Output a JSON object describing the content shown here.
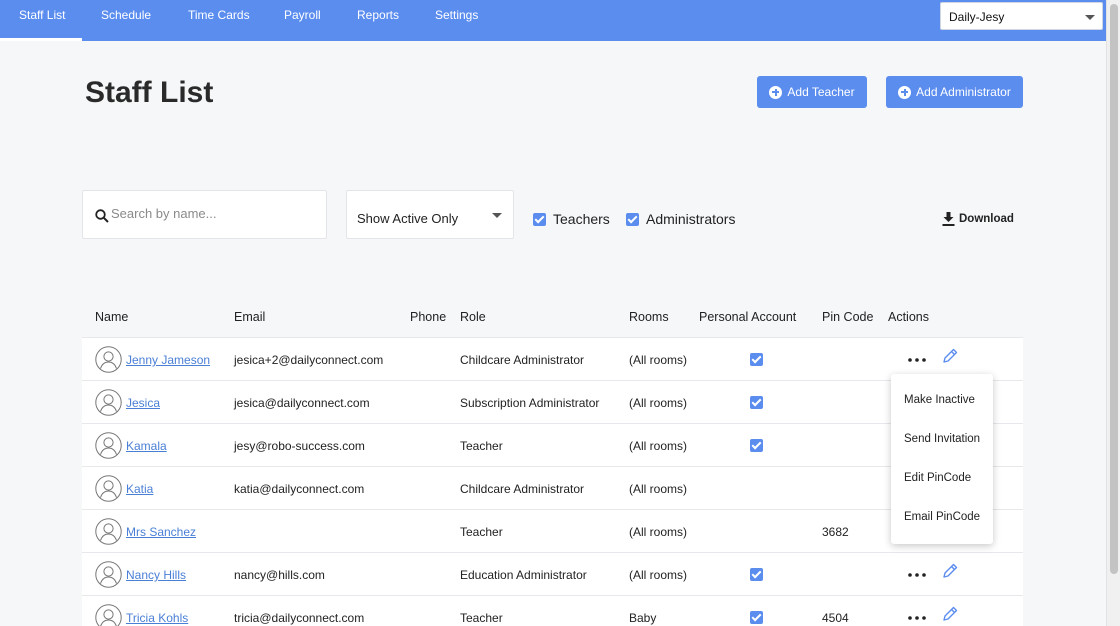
{
  "nav": {
    "items": [
      "Staff List",
      "Schedule",
      "Time Cards",
      "Payroll",
      "Reports",
      "Settings"
    ],
    "account": "Daily-Jesy"
  },
  "page": {
    "title": "Staff List"
  },
  "buttons": {
    "add_teacher": "Add Teacher",
    "add_admin": "Add Administrator",
    "download": "Download"
  },
  "filters": {
    "search_placeholder": "Search by name...",
    "status": "Show Active Only",
    "teachers": "Teachers",
    "administrators": "Administrators"
  },
  "table": {
    "headers": [
      "Name",
      "Email",
      "Phone",
      "Role",
      "Rooms",
      "Personal Account",
      "Pin Code",
      "Actions"
    ],
    "rows": [
      {
        "name": "Jenny Jameson",
        "email": "jesica+2@dailyconnect.com",
        "role": "Childcare Administrator",
        "rooms": "(All rooms)",
        "personal": true,
        "pin": ""
      },
      {
        "name": "Jesica",
        "email": "jesica@dailyconnect.com",
        "role": "Subscription Administrator",
        "rooms": "(All rooms)",
        "personal": true,
        "pin": ""
      },
      {
        "name": "Kamala",
        "email": "jesy@robo-success.com",
        "role": "Teacher",
        "rooms": "(All rooms)",
        "personal": true,
        "pin": ""
      },
      {
        "name": "Katia",
        "email": "katia@dailyconnect.com",
        "role": "Childcare Administrator",
        "rooms": "(All rooms)",
        "personal": false,
        "pin": ""
      },
      {
        "name": "Mrs Sanchez",
        "email": "",
        "role": "Teacher",
        "rooms": "(All rooms)",
        "personal": false,
        "pin": "3682"
      },
      {
        "name": "Nancy Hills",
        "email": "nancy@hills.com",
        "role": "Education Administrator",
        "rooms": "(All rooms)",
        "personal": true,
        "pin": ""
      },
      {
        "name": "Tricia Kohls",
        "email": "tricia@dailyconnect.com",
        "role": "Teacher",
        "rooms": "Baby",
        "personal": true,
        "pin": "4504"
      }
    ]
  },
  "menu": {
    "items": [
      "Make Inactive",
      "Send Invitation",
      "Edit PinCode",
      "Email PinCode"
    ]
  },
  "colors": {
    "primary": "#5b8def",
    "link": "#4a7fd6"
  }
}
